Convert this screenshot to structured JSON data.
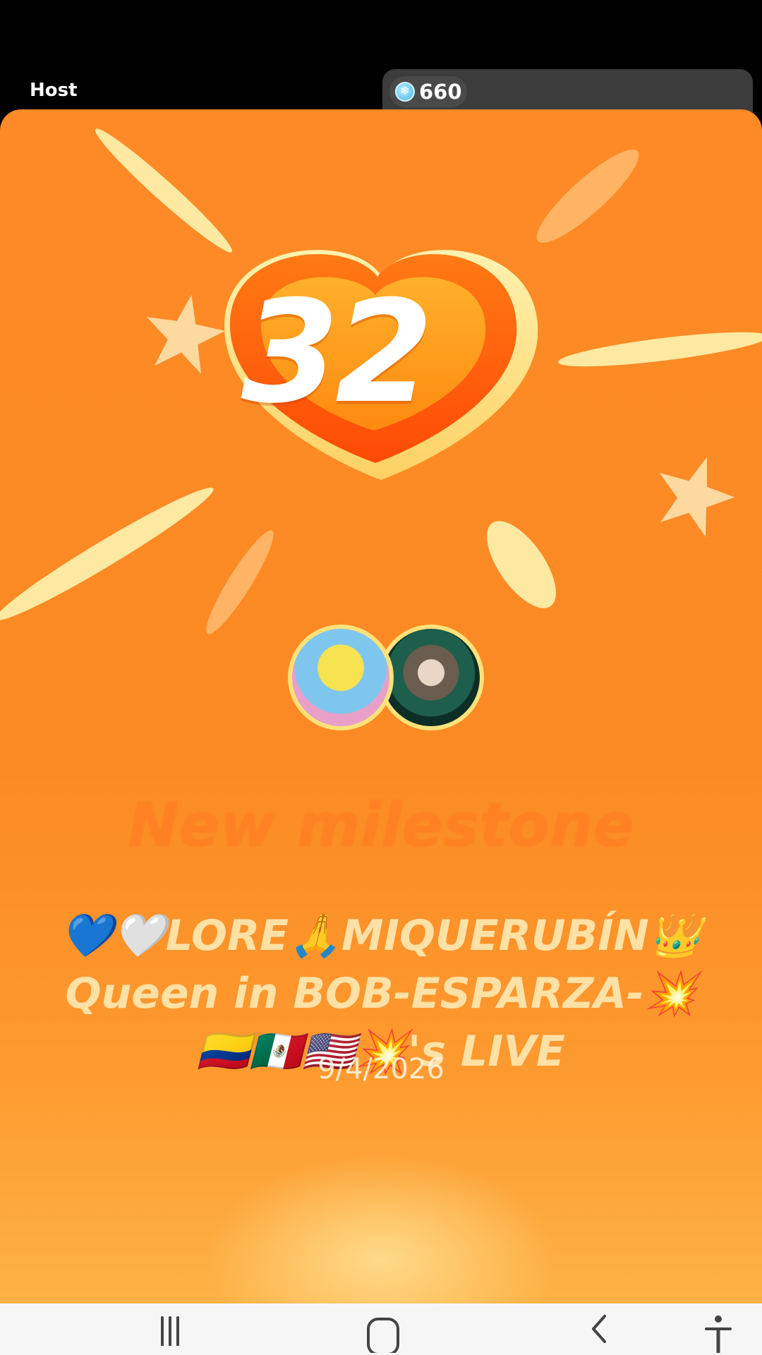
{
  "header": {
    "host_label": "Host",
    "coin_count": "660",
    "coin_icon": "snowflake-coin-icon"
  },
  "milestone": {
    "number": "32",
    "heading": "New milestone",
    "title_line1": "💙🤍LORE🙏MIQUERUBÍN👑",
    "title_line2": "Queen in BOB-ESPARZA-💥",
    "title_line3": "🇨🇴🇲🇽🇺🇸💥's LIVE",
    "date": "9/4/2026"
  },
  "nav": {
    "recents_icon": "recent-apps-icon",
    "home_icon": "home-icon",
    "back_icon": "back-icon",
    "accessibility_icon": "accessibility-icon"
  },
  "colors": {
    "card_orange": "#fc8a24",
    "ray_yellow": "#fde9a2",
    "heart_outer": "#ff5a0d",
    "heart_inner": "#ff9a1a",
    "title_text": "#ffe1a6"
  }
}
